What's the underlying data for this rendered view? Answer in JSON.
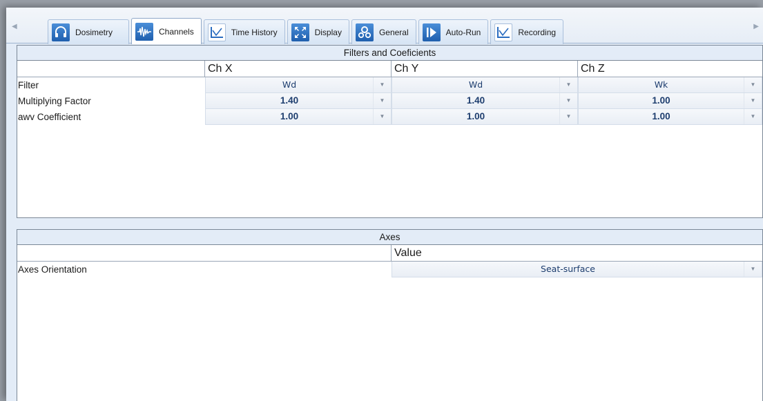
{
  "tabs": [
    {
      "label": "Dosimetry",
      "icon": "headphones-icon",
      "active": false
    },
    {
      "label": "Channels",
      "icon": "waveform-icon",
      "active": true
    },
    {
      "label": "Time History",
      "icon": "line-chart-icon",
      "active": false
    },
    {
      "label": "Display",
      "icon": "expand-icon",
      "active": false
    },
    {
      "label": "General",
      "icon": "gears-icon",
      "active": false
    },
    {
      "label": "Auto-Run",
      "icon": "play-icon",
      "active": false
    },
    {
      "label": "Recording",
      "icon": "line-chart-icon",
      "active": false
    }
  ],
  "filters": {
    "title": "Filters and Coeficients",
    "columns": [
      "Ch X",
      "Ch Y",
      "Ch Z"
    ],
    "rows": [
      {
        "label": "Filter",
        "values": [
          "Wd",
          "Wd",
          "Wk"
        ]
      },
      {
        "label": "Multiplying Factor",
        "values": [
          "1.40",
          "1.40",
          "1.00"
        ]
      },
      {
        "label": "awv Coefficient",
        "values": [
          "1.00",
          "1.00",
          "1.00"
        ]
      }
    ]
  },
  "axes": {
    "title": "Axes",
    "column": "Value",
    "rows": [
      {
        "label": "Axes Orientation",
        "value": "Seat-surface"
      }
    ]
  },
  "colors": {
    "accent": "#2a6cc0",
    "value_text": "#1d3d6e",
    "panel_bg": "#e3ecf7"
  }
}
